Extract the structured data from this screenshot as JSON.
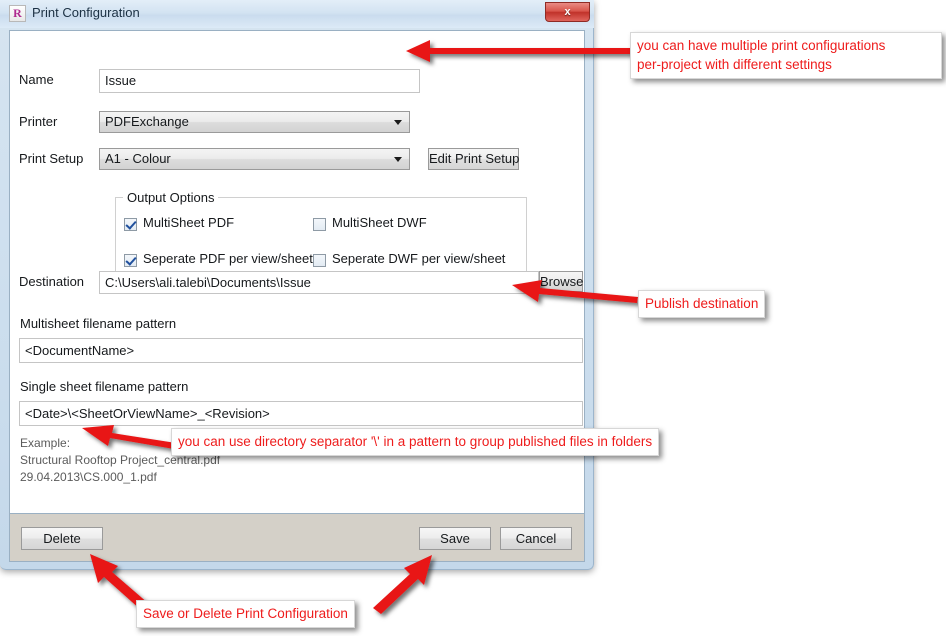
{
  "window": {
    "title": "Print Configuration",
    "icon": "revit-r-icon",
    "icon_letter": "R",
    "close_label": "x"
  },
  "form": {
    "name_label": "Name",
    "name_value": "Issue",
    "printer_label": "Printer",
    "printer_value": "PDFExchange",
    "print_setup_label": "Print Setup",
    "print_setup_value": "A1 - Colour",
    "edit_print_setup_label": "Edit Print Setup",
    "destination_label": "Destination",
    "destination_value": "C:\\Users\\ali.talebi\\Documents\\Issue",
    "browse_label": "Browse",
    "multisheet_pattern_label": "Multisheet filename pattern",
    "multisheet_pattern_value": "<DocumentName>",
    "singlesheet_pattern_label": "Single sheet filename pattern",
    "singlesheet_pattern_value": "<Date>\\<SheetOrViewName>_<Revision>"
  },
  "output_options": {
    "legend": "Output Options",
    "items": [
      {
        "label": "MultiSheet PDF",
        "checked": true
      },
      {
        "label": "MultiSheet DWF",
        "checked": false
      },
      {
        "label": "Seperate PDF per view/sheet",
        "checked": true
      },
      {
        "label": "Seperate DWF per view/sheet",
        "checked": false
      }
    ]
  },
  "example": {
    "heading": "Example:",
    "lines": [
      "Structural Rooftop Project_central.pdf",
      "29.04.2013\\CS.000_1.pdf"
    ]
  },
  "footer": {
    "delete_label": "Delete",
    "save_label": "Save",
    "cancel_label": "Cancel"
  },
  "annotations": {
    "color": "#ee1c1c",
    "name_note_line1": "you can have multiple print configurations",
    "name_note_line2": "per-project with different settings",
    "destination_note": "Publish destination",
    "pattern_note": "you can use directory separator '\\' in a pattern to group published files in folders",
    "footer_note": "Save or Delete Print Configuration"
  }
}
